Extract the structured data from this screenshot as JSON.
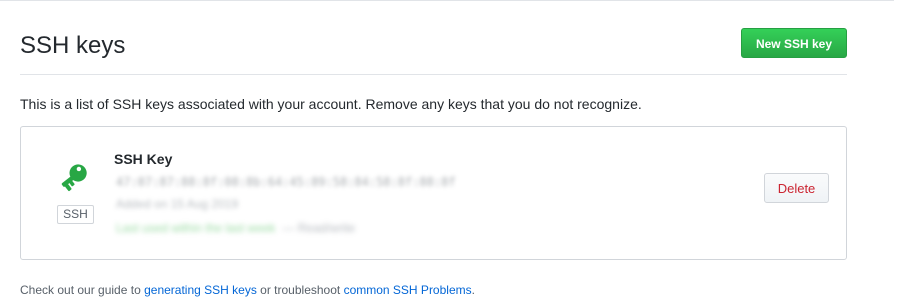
{
  "header": {
    "title": "SSH keys",
    "new_key_label": "New SSH key"
  },
  "description": "This is a list of SSH keys associated with your account. Remove any keys that you do not recognize.",
  "ssh_keys": [
    {
      "icon": "key-icon",
      "type_badge": "SSH",
      "title": "SSH Key",
      "fingerprint": "47:07:87:88:8f:08:8b:64:45:89:58:84:58:8f:88:8f",
      "added": "Added on 15 Aug 2019",
      "last_used": "Last used within the last week",
      "access": "— Read/write",
      "delete_label": "Delete"
    }
  ],
  "help": {
    "prefix": "Check out our guide to",
    "generating_link": "generating SSH keys",
    "middle": "or troubleshoot",
    "problems_link": "common SSH Problems",
    "suffix": "."
  },
  "colors": {
    "primary_button": "#28a745",
    "key_icon": "#28a745",
    "link": "#0366d6",
    "delete_text": "#cb2431",
    "border": "#d1d5da"
  }
}
